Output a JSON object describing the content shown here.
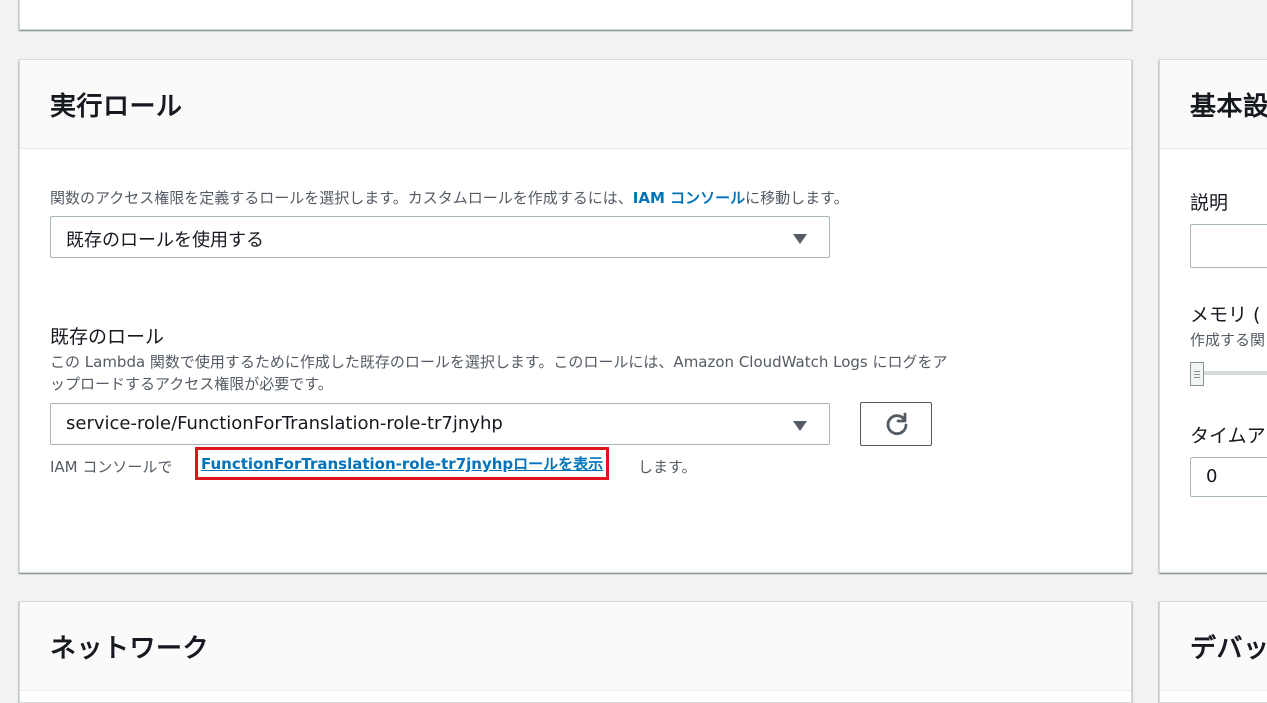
{
  "role_panel": {
    "title": "実行ロール",
    "description_before": "関数のアクセス権限を定義するロールを選択します。カスタムロールを作成するには、",
    "description_link": "IAM コンソール",
    "description_after": "に移動します。",
    "role_mode_select": "既存のロールを使用する",
    "existing_role_label": "既存のロール",
    "existing_role_desc_line1": "この Lambda 関数で使用するために作成した既存のロールを選択します。このロールには、Amazon CloudWatch Logs にログをア",
    "existing_role_desc_line2": "ップロードするアクセス権限が必要です。",
    "existing_role_select": "service-role/FunctionForTranslation-role-tr7jnyhp",
    "view_prefix": "IAM コンソールで",
    "view_link": "FunctionForTranslation-role-tr7jnyhpロールを表示",
    "view_suffix": "します。"
  },
  "basic_panel": {
    "title": "基本設",
    "description_label": "説明",
    "memory_label": "メモリ (",
    "memory_hint": "作成する関",
    "timeout_label": "タイムア",
    "timeout_value": "0"
  },
  "network_panel": {
    "title": "ネットワーク"
  },
  "debug_panel": {
    "title": "デバッ"
  }
}
